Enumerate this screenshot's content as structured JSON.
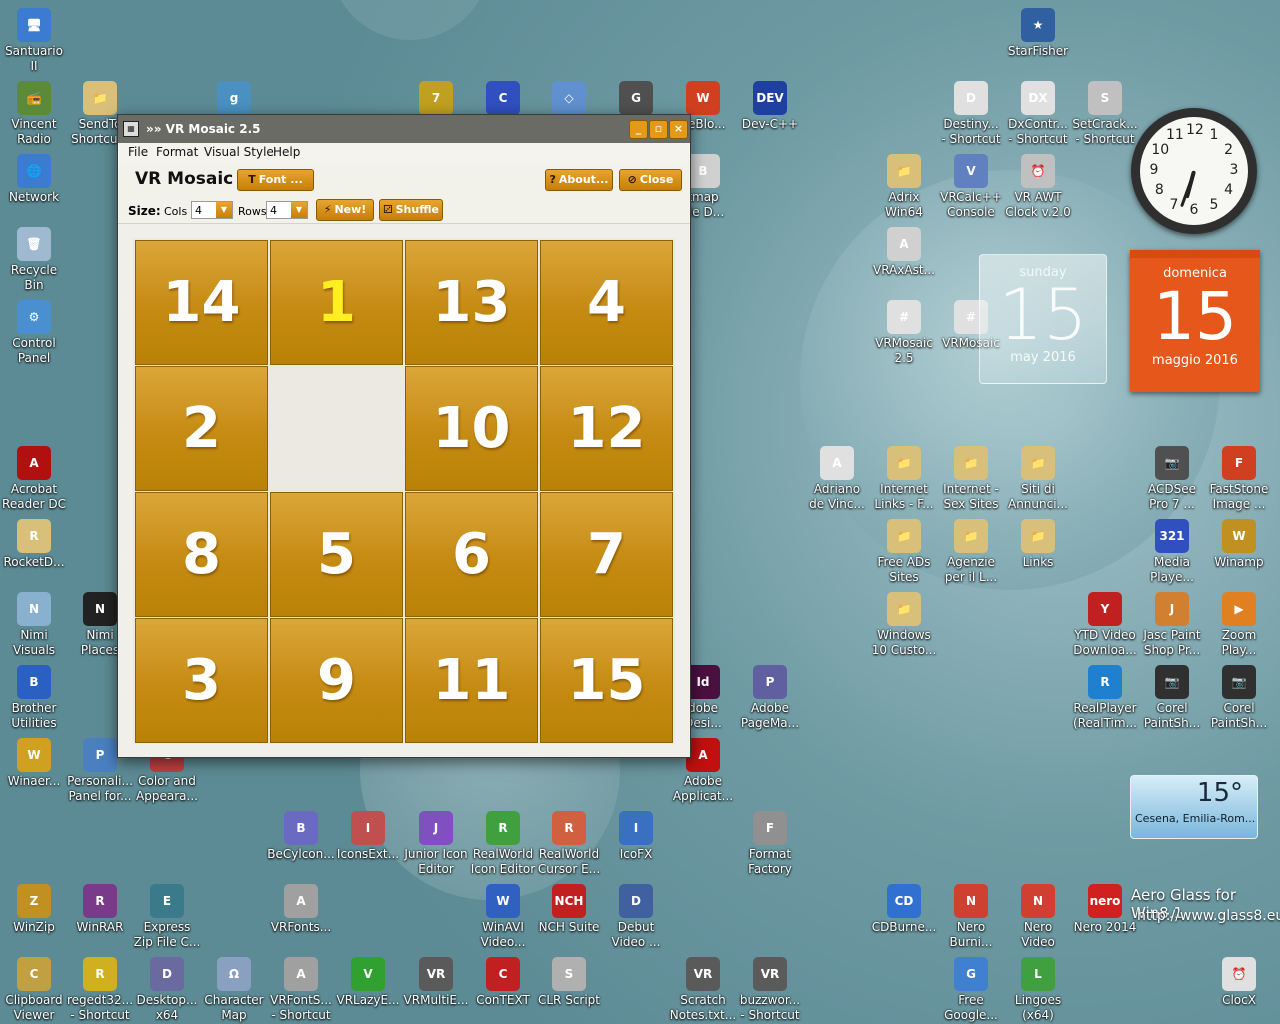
{
  "window": {
    "title": "»» VR Mosaic 2.5",
    "menu": [
      "File",
      "Format",
      "Visual Style",
      "Help"
    ],
    "app_title": "VR Mosaic",
    "font_button": "Font ...",
    "about_button": "About...",
    "close_button": "Close",
    "size_label": "Size:",
    "cols_label": "Cols",
    "cols_value": "4",
    "rows_label": "Rows",
    "rows_value": "4",
    "new_button": "New!",
    "shuffle_button": "Shuffle",
    "tiles": [
      "14",
      "1",
      "13",
      "4",
      "2",
      "",
      "10",
      "12",
      "8",
      "5",
      "6",
      "7",
      "3",
      "9",
      "11",
      "15"
    ],
    "highlighted_tile": "1",
    "accent_color": "#c88a10"
  },
  "desktop_icons": [
    {
      "label": "Santuario\nII",
      "color": "#3b7bd0",
      "glyph": "🖥"
    },
    {
      "label": "Vincent\nRadio",
      "color": "#5a8a3a",
      "glyph": "📻"
    },
    {
      "label": "SendTo\nShortcu...",
      "color": "#d8c07a",
      "glyph": "📁"
    },
    {
      "label": "Network",
      "color": "#3b7bd0",
      "glyph": "🌐"
    },
    {
      "label": "Recycle\nBin",
      "color": "#9fbad0",
      "glyph": "🗑"
    },
    {
      "label": "Control\nPanel",
      "color": "#4a90d0",
      "glyph": "⚙"
    },
    {
      "label": "Acrobat\nReader DC",
      "color": "#b01010",
      "glyph": "A"
    },
    {
      "label": "RocketD...",
      "color": "#d8c07a",
      "glyph": "R"
    },
    {
      "label": "Nimi\nVisuals",
      "color": "#8ab0d0",
      "glyph": "N"
    },
    {
      "label": "Nimi\nPlaces",
      "color": "#222222",
      "glyph": "N"
    },
    {
      "label": "Brother\nUtilities",
      "color": "#2a60c0",
      "glyph": "B"
    },
    {
      "label": "Winaer...",
      "color": "#d0a020",
      "glyph": "W"
    },
    {
      "label": "Personali...\nPanel for...",
      "color": "#4a80c0",
      "glyph": "P"
    },
    {
      "label": "Color and\nAppeara...",
      "color": "#c04040",
      "glyph": "C"
    },
    {
      "label": "WinZip",
      "color": "#c09020",
      "glyph": "Z"
    },
    {
      "label": "WinRAR",
      "color": "#7a3a8a",
      "glyph": "R"
    },
    {
      "label": "Express\nZip File C...",
      "color": "#3a7a8a",
      "glyph": "E"
    },
    {
      "label": "Clipboard\nViewer",
      "color": "#c0a040",
      "glyph": "C"
    },
    {
      "label": "regedt32...\n- Shortcut",
      "color": "#d0b020",
      "glyph": "R"
    },
    {
      "label": "Desktop...\nx64",
      "color": "#6a6aa0",
      "glyph": "D"
    },
    {
      "label": "Character\nMap",
      "color": "#8aa0c0",
      "glyph": "Ω"
    },
    {
      "label": "VRFontS...\n- Shortcut",
      "color": "#a0a0a0",
      "glyph": "A"
    },
    {
      "label": "VRLazyE...",
      "color": "#30a030",
      "glyph": "V"
    },
    {
      "label": "VRMultiE...",
      "color": "#5a5a5a",
      "glyph": "VR"
    },
    {
      "label": "ConTEXT",
      "color": "#c02020",
      "glyph": "C"
    },
    {
      "label": "CLR Script",
      "color": "#b0b0b0",
      "glyph": "S"
    },
    {
      "label": "BeCylcon...",
      "color": "#6a6ac0",
      "glyph": "B"
    },
    {
      "label": "IconsExt...",
      "color": "#c05050",
      "glyph": "I"
    },
    {
      "label": "Junior Icon\nEditor",
      "color": "#8050c0",
      "glyph": "J"
    },
    {
      "label": "RealWorld\nIcon Editor",
      "color": "#40a040",
      "glyph": "R"
    },
    {
      "label": "RealWorld\nCursor E...",
      "color": "#d06040",
      "glyph": "R"
    },
    {
      "label": "IcoFX",
      "color": "#3a70c0",
      "glyph": "I"
    },
    {
      "label": "VRFonts...",
      "color": "#a0a0a0",
      "glyph": "A"
    },
    {
      "label": "WinAVI\nVideo...",
      "color": "#3060c0",
      "glyph": "W"
    },
    {
      "label": "NCH Suite",
      "color": "#c02020",
      "glyph": "NCH"
    },
    {
      "label": "Debut\nVideo ...",
      "color": "#4060a0",
      "glyph": "D"
    },
    {
      "label": "Format\nFactory",
      "color": "#909090",
      "glyph": "F"
    },
    {
      "label": "Scratch\nNotes.txt...",
      "color": "#5a5a5a",
      "glyph": "VR"
    },
    {
      "label": "buzzwor...\n- Shortcut",
      "color": "#5a5a5a",
      "glyph": "VR"
    },
    {
      "label": "dobe\nDesi...",
      "color": "#4a1040",
      "glyph": "Id"
    },
    {
      "label": "Adobe\nPageMa...",
      "color": "#6060a0",
      "glyph": "P"
    },
    {
      "label": "Adobe\nApplicat...",
      "color": "#c01010",
      "glyph": "A"
    },
    {
      "label": "deBlo...",
      "color": "#d04020",
      "glyph": "W"
    },
    {
      "label": "Dev-C++",
      "color": "#2040a0",
      "glyph": "DEV"
    },
    {
      "label": "tmap\nyle D...",
      "color": "#d0d0d0",
      "glyph": "B"
    },
    {
      "label": "StarFisher",
      "color": "#3060a0",
      "glyph": "★"
    },
    {
      "label": "Destiny...\n- Shortcut",
      "color": "#e0e0e0",
      "glyph": "D"
    },
    {
      "label": "DxContr...\n- Shortcut",
      "color": "#e0e0e0",
      "glyph": "DX"
    },
    {
      "label": "SetCrack...\n- Shortcut",
      "color": "#c0c0c0",
      "glyph": "S"
    },
    {
      "label": "Adrix\nWin64",
      "color": "#d8c07a",
      "glyph": "📁"
    },
    {
      "label": "VRCalc++\nConsole",
      "color": "#6080c0",
      "glyph": "V"
    },
    {
      "label": "VR AWT\nClock v.2.0",
      "color": "#c0c0c0",
      "glyph": "⏰"
    },
    {
      "label": "VRAxAst...",
      "color": "#d0d0d0",
      "glyph": "A"
    },
    {
      "label": "VRMosaic\n2.5",
      "color": "#e0e0e0",
      "glyph": "#"
    },
    {
      "label": "VRMosaic",
      "color": "#e0e0e0",
      "glyph": "#"
    },
    {
      "label": "Adriano\nde Vinc...",
      "color": "#e0e0e0",
      "glyph": "A"
    },
    {
      "label": "Internet\nLinks - F...",
      "color": "#d8c07a",
      "glyph": "📁"
    },
    {
      "label": "Internet -\nSex Sites",
      "color": "#d8c07a",
      "glyph": "📁"
    },
    {
      "label": "Siti di\nAnnunci...",
      "color": "#d8c07a",
      "glyph": "📁"
    },
    {
      "label": "Free ADs\nSites",
      "color": "#d8c07a",
      "glyph": "📁"
    },
    {
      "label": "Agenzie\nper il L...",
      "color": "#d8c07a",
      "glyph": "📁"
    },
    {
      "label": "Links",
      "color": "#d8c07a",
      "glyph": "📁"
    },
    {
      "label": "Windows\n10 Custo...",
      "color": "#d8c07a",
      "glyph": "📁"
    },
    {
      "label": "ACDSee\nPro 7 ...",
      "color": "#505050",
      "glyph": "📷"
    },
    {
      "label": "FastStone\nImage ...",
      "color": "#d04020",
      "glyph": "F"
    },
    {
      "label": "Media\nPlaye...",
      "color": "#3050c0",
      "glyph": "321"
    },
    {
      "label": "Winamp",
      "color": "#c09020",
      "glyph": "W"
    },
    {
      "label": "YTD Video\nDownloa...",
      "color": "#c02020",
      "glyph": "Y"
    },
    {
      "label": "Jasc Paint\nShop Pr...",
      "color": "#d08030",
      "glyph": "J"
    },
    {
      "label": "Zoom\nPlay...",
      "color": "#e08020",
      "glyph": "▶"
    },
    {
      "label": "RealPlayer\n(RealTim...",
      "color": "#2080d0",
      "glyph": "R"
    },
    {
      "label": "Corel\nPaintSh...",
      "color": "#303030",
      "glyph": "📷"
    },
    {
      "label": "Corel\nPaintSh...",
      "color": "#303030",
      "glyph": "📷"
    },
    {
      "label": "CDBurne...",
      "color": "#3070d0",
      "glyph": "CD"
    },
    {
      "label": "Nero\nBurni...",
      "color": "#d04030",
      "glyph": "N"
    },
    {
      "label": "Nero\nVideo",
      "color": "#d04030",
      "glyph": "N"
    },
    {
      "label": "Nero 2014",
      "color": "#d02020",
      "glyph": "nero"
    },
    {
      "label": "Free\nGoogle...",
      "color": "#4080d0",
      "glyph": "G"
    },
    {
      "label": "Lingoes\n(x64)",
      "color": "#40a040",
      "glyph": "L"
    },
    {
      "label": "ClocX",
      "color": "#e0e0e0",
      "glyph": "⏰"
    },
    {
      "label": "",
      "color": "#4a90c0",
      "glyph": "g"
    },
    {
      "label": "",
      "color": "#c0a020",
      "glyph": "7"
    },
    {
      "label": "",
      "color": "#3050c0",
      "glyph": "C"
    },
    {
      "label": "",
      "color": "#6090d0",
      "glyph": "◇"
    },
    {
      "label": "",
      "color": "#505050",
      "glyph": "G"
    }
  ],
  "gadgets": {
    "clock_numbers": [
      "12",
      "1",
      "2",
      "3",
      "4",
      "5",
      "6",
      "7",
      "8",
      "9",
      "10",
      "11"
    ],
    "cal1_day": "sunday",
    "cal1_date": "15",
    "cal1_month": "may 2016",
    "cal2_day": "domenica",
    "cal2_date": "15",
    "cal2_month": "maggio 2016",
    "weather_temp": "15°",
    "weather_place": "Cesena, Emilia-Rom...",
    "aero_title": "Aero Glass for Win8.1",
    "aero_url": "http://www.glass8.eu"
  }
}
